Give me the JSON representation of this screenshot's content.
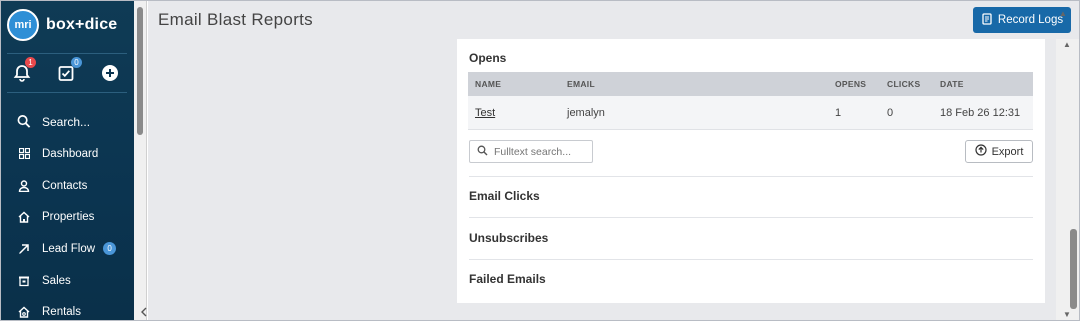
{
  "app": {
    "brand_logo": "mri",
    "brand_name": "box+dice"
  },
  "quick": {
    "notifications_count": "1",
    "tasks_count": "0"
  },
  "sidebar": {
    "items": [
      {
        "label": "Search...",
        "icon": "search-icon"
      },
      {
        "label": "Dashboard",
        "icon": "dashboard-icon"
      },
      {
        "label": "Contacts",
        "icon": "contacts-icon"
      },
      {
        "label": "Properties",
        "icon": "home-icon"
      },
      {
        "label": "Lead Flow",
        "icon": "lead-flow-icon",
        "badge": "0"
      },
      {
        "label": "Sales",
        "icon": "sales-icon"
      },
      {
        "label": "Rentals",
        "icon": "rentals-icon"
      }
    ]
  },
  "header": {
    "title": "Email Blast Reports",
    "record_logs_label": "Record Logs"
  },
  "opens": {
    "title": "Opens",
    "columns": [
      "NAME",
      "EMAIL",
      "OPENS",
      "CLICKS",
      "DATE"
    ],
    "rows": [
      {
        "name": "Test",
        "email": "jemalyn",
        "opens": "1",
        "clicks": "0",
        "date": "18 Feb 26 12:31"
      }
    ],
    "search_placeholder": "Fulltext search...",
    "export_label": "Export"
  },
  "sections": {
    "email_clicks": "Email Clicks",
    "unsubscribes": "Unsubscribes",
    "failed_emails": "Failed Emails"
  },
  "colors": {
    "sidebar_bg": "#0b3450",
    "primary_button": "#1869a8",
    "badge_red": "#e8494c",
    "badge_blue": "#4a96d8"
  }
}
